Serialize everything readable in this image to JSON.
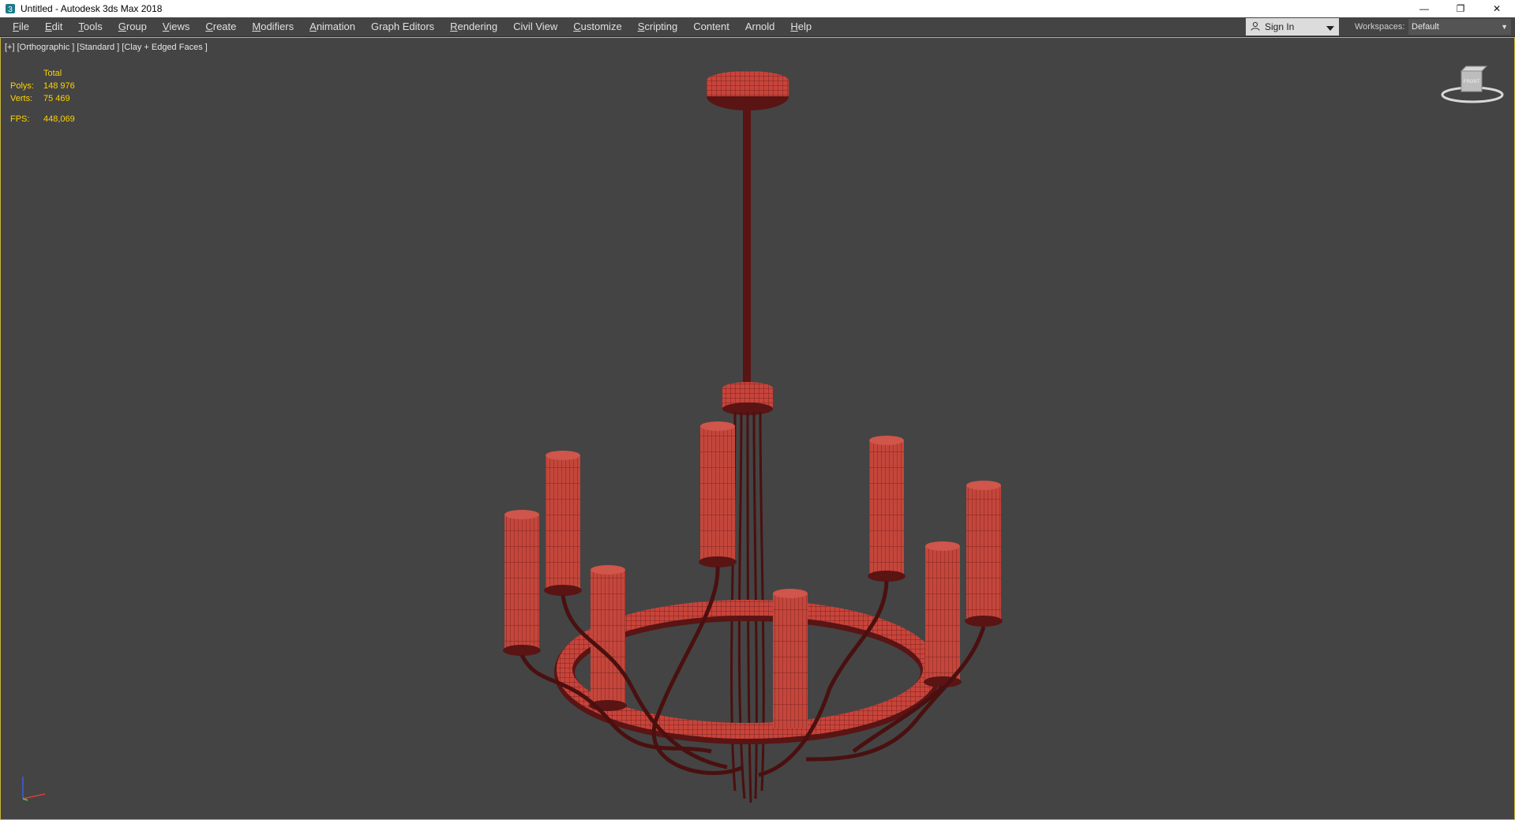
{
  "window": {
    "title": "Untitled - Autodesk 3ds Max 2018",
    "controls": {
      "minimize": "—",
      "restore": "❐",
      "close": "✕"
    }
  },
  "menu": {
    "items": [
      {
        "label": "File",
        "accel": "F",
        "rest": "ile"
      },
      {
        "label": "Edit",
        "accel": "E",
        "rest": "dit"
      },
      {
        "label": "Tools",
        "accel": "T",
        "rest": "ools"
      },
      {
        "label": "Group",
        "accel": "G",
        "rest": "roup"
      },
      {
        "label": "Views",
        "accel": "V",
        "rest": "iews"
      },
      {
        "label": "Create",
        "accel": "C",
        "rest": "reate"
      },
      {
        "label": "Modifiers",
        "accel": "M",
        "rest": "odifiers"
      },
      {
        "label": "Animation",
        "accel": "A",
        "rest": "nimation"
      },
      {
        "label": "Graph Editors",
        "accel": "",
        "rest": "Graph Editors"
      },
      {
        "label": "Rendering",
        "accel": "R",
        "rest": "endering"
      },
      {
        "label": "Civil View",
        "accel": "",
        "rest": "Civil View"
      },
      {
        "label": "Customize",
        "accel": "C",
        "rest": "ustomize"
      },
      {
        "label": "Scripting",
        "accel": "S",
        "rest": "cripting"
      },
      {
        "label": "Content",
        "accel": "",
        "rest": "Content"
      },
      {
        "label": "Arnold",
        "accel": "",
        "rest": "Arnold"
      },
      {
        "label": "Help",
        "accel": "H",
        "rest": "elp"
      }
    ]
  },
  "account": {
    "signin_label": "Sign In"
  },
  "workspaces": {
    "label": "Workspaces:",
    "value": "Default"
  },
  "viewport": {
    "label": "[+] [Orthographic ] [Standard ] [Clay + Edged Faces ]",
    "stats": {
      "header": "Total",
      "polys_label": "Polys:",
      "polys_value": "148 976",
      "verts_label": "Verts:",
      "verts_value": "75 469",
      "fps_label": "FPS:",
      "fps_value": "448,069"
    },
    "viewcube_face": "FRONT",
    "object_color": "#c8443a",
    "wire_color": "#5a1414"
  }
}
